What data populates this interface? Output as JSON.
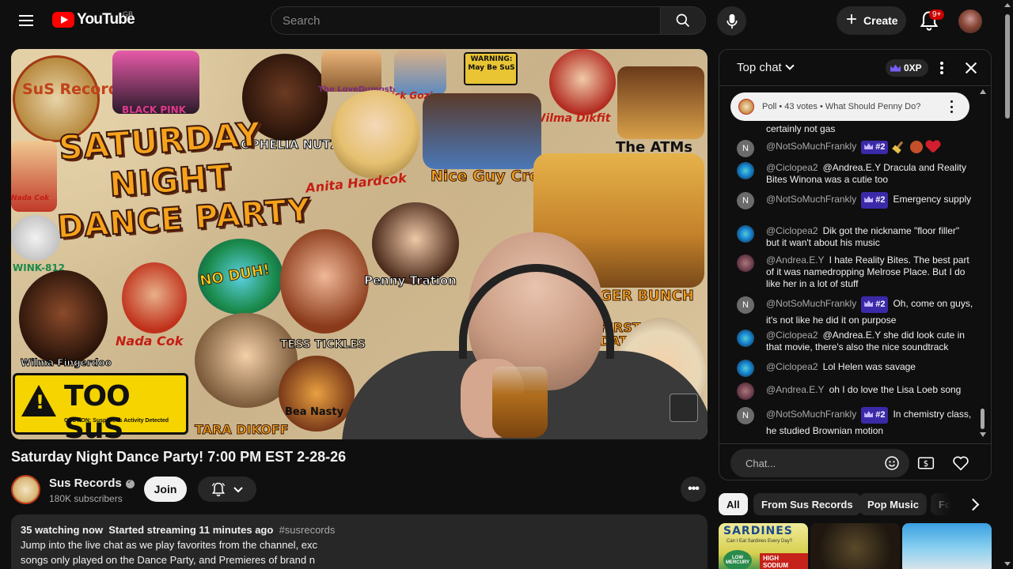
{
  "header": {
    "logo_text": "YouTube",
    "region": "GB",
    "search_placeholder": "Search",
    "create_label": "Create",
    "notification_count": "9+"
  },
  "video": {
    "thumb_text": {
      "title_line1": "SATURDAY",
      "title_line2": "NIGHT",
      "title_line3": "DANCE PARTY",
      "sus_records": "SuS Records",
      "black_pink": "BLACK PINK",
      "ophelia": "OPHELIA NUTZ",
      "love_dumpsters": "The LoveDumpsters",
      "dick": "Dick Gozinya",
      "warning": "WARNING: May Be SuS",
      "wilma_dikfit": "Wilma Dikfit",
      "atms": "The ATMs",
      "anita": "Anita Hardcok",
      "nice_guy": "Nice Guy Crew",
      "nada": "Nada Cok",
      "wink": "WINK-812",
      "no_duh": "NO DUH!",
      "penny": "Penny Tration",
      "bunch": "GER BUNCH",
      "tess": "TESS TICKLES",
      "wilma_f": "Wilma Fingerdoo",
      "too_sus": "TOO SuS",
      "caution": "CAUTION: Suspicious Activity Detected",
      "bea": "Bea Nasty",
      "tara": "TARA DIKOFF",
      "first_date": "FIRST DATE",
      "cok": "cok"
    },
    "title": "Saturday Night Dance Party! 7:00 PM EST 2-28-26"
  },
  "channel": {
    "name": "Sus Records",
    "subscribers": "180K subscribers",
    "join_label": "Join",
    "more_label": "•••"
  },
  "description": {
    "watching": "35 watching now",
    "started": "Started streaming 11 minutes ago",
    "hashtag": "#susrecords",
    "line2": "Jump into the live chat as we play favorites from the channel, exc",
    "line3": "songs only played on the Dance Party, and Premieres of brand n"
  },
  "chat": {
    "title": "Top chat",
    "xp_label": "0XP",
    "faded_text": "...",
    "poll_text": "Poll • 43 votes • What Should Penny Do?",
    "input_placeholder": "Chat...",
    "messages": [
      {
        "avatar": "",
        "author": "",
        "badge": "",
        "text": "certainly not gas"
      },
      {
        "avatar": "N",
        "author": "@NotSoMuchFrankly",
        "badge": "#2",
        "text": ""
      },
      {
        "avatar": "",
        "author": "@Ciclopea2",
        "badge": "",
        "text": "@Andrea.E.Y Dracula and Reality Bites Winona was a cutie too"
      },
      {
        "avatar": "N",
        "author": "@NotSoMuchFrankly",
        "badge": "#2",
        "text": "Emergency supply"
      },
      {
        "avatar": "",
        "author": "@Ciclopea2",
        "badge": "",
        "text": "Dik got the nickname \"floor filler\" but it wan't about his music"
      },
      {
        "avatar": "",
        "author": "@Andrea.E.Y",
        "badge": "",
        "text": "I hate Reality Bites. The best part of it was namedropping Melrose Place. But I do like her in a lot of stuff"
      },
      {
        "avatar": "N",
        "author": "@NotSoMuchFrankly",
        "badge": "#2",
        "text": "Oh, come on guys, it's not like he did it on purpose"
      },
      {
        "avatar": "",
        "author": "@Ciclopea2",
        "badge": "",
        "text": "@Andrea.E.Y she did look cute in that movie, there's also the nice soundtrack"
      },
      {
        "avatar": "",
        "author": "@Ciclopea2",
        "badge": "",
        "text": "Lol Helen was savage"
      },
      {
        "avatar": "",
        "author": "@Andrea.E.Y",
        "badge": "",
        "text": "oh I do love the Lisa Loeb song"
      },
      {
        "avatar": "N",
        "author": "@NotSoMuchFrankly",
        "badge": "#2",
        "text": "In chemistry class, he studied Brownian motion"
      }
    ]
  },
  "chips": [
    "All",
    "From Sus Records",
    "Pop Music",
    "Fo"
  ],
  "recs": {
    "rec1_title": "SARDINES",
    "rec1_sub": "Can I Eat Sardines Every Day?",
    "rec1_low": "LOW MERCURY",
    "rec1_high": "HIGH SODIUM"
  },
  "icons": {
    "menu": "menu-icon",
    "search": "search-icon",
    "mic": "mic-icon",
    "bell": "bell-icon",
    "emoji": "emoji-icon",
    "super_chat": "super-chat-icon",
    "heart": "heart-icon"
  },
  "colors": {
    "background": "#0f0f0f",
    "brand_red": "#ff0000",
    "chip_bg": "#272727",
    "member_badge": "#3b2aa8"
  }
}
